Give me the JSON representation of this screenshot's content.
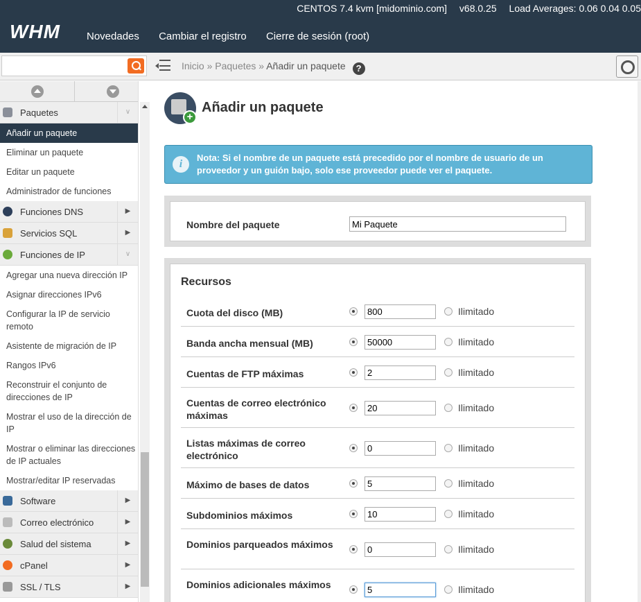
{
  "header": {
    "server": "CENTOS 7.4 kvm [midominio.com]",
    "version": "v68.0.25",
    "load": "Load Averages: 0.06 0.04 0.05",
    "logo": "WHM",
    "nav": [
      "Novedades",
      "Cambiar el registro",
      "Cierre de sesión (root)"
    ]
  },
  "search": {
    "placeholder": ""
  },
  "breadcrumb": {
    "home": "Inicio »",
    "section": "Paquetes »",
    "current": "Añadir un paquete",
    "help": "?"
  },
  "sidebar": {
    "cat_packages": "Paquetes",
    "package_items": [
      "Añadir un paquete",
      "Eliminar un paquete",
      "Editar un paquete",
      "Administrador de funciones"
    ],
    "cat_dns": "Funciones DNS",
    "cat_sql": "Servicios SQL",
    "cat_ip": "Funciones de IP",
    "ip_items": [
      "Agregar una nueva dirección IP",
      "Asignar direcciones IPv6",
      "Configurar la IP de servicio remoto",
      "Asistente de migración de IP",
      "Rangos IPv6",
      "Reconstruir el conjunto de direcciones de IP",
      "Mostrar el uso de la dirección de IP",
      "Mostrar o eliminar las direcciones de IP actuales",
      "Mostrar/editar IP reservadas"
    ],
    "cat_software": "Software",
    "cat_mail": "Correo electrónico",
    "cat_health": "Salud del sistema",
    "cat_cpanel": "cPanel",
    "cat_ssl": "SSL / TLS"
  },
  "page": {
    "title": "Añadir un paquete",
    "note": "Nota: Si el nombre de un paquete está precedido por el nombre de usuario de un proveedor y un guión bajo, solo ese proveedor puede ver el paquete.",
    "name_label": "Nombre del paquete",
    "name_value": "Mi Paquete",
    "resources_title": "Recursos",
    "unlimited": "Ilimitado",
    "rows": [
      {
        "label": "Cuota del disco (MB)",
        "value": "800"
      },
      {
        "label": "Banda ancha mensual (MB)",
        "value": "50000"
      },
      {
        "label": "Cuentas de FTP máximas",
        "value": "2"
      },
      {
        "label": "Cuentas de correo electrónico máximas",
        "value": "20"
      },
      {
        "label": "Listas máximas de correo electrónico",
        "value": "0"
      },
      {
        "label": "Máximo de bases de datos",
        "value": "5"
      },
      {
        "label": "Subdominios máximos",
        "value": "10"
      },
      {
        "label": "Dominios parqueados máximos",
        "value": "0"
      },
      {
        "label": "Dominios adicionales máximos",
        "value": "5"
      }
    ]
  },
  "colors": {
    "header": "#293a4a",
    "note": "#5fb4d6",
    "search_button": "#f26c22",
    "active_item": "#293a4a"
  }
}
